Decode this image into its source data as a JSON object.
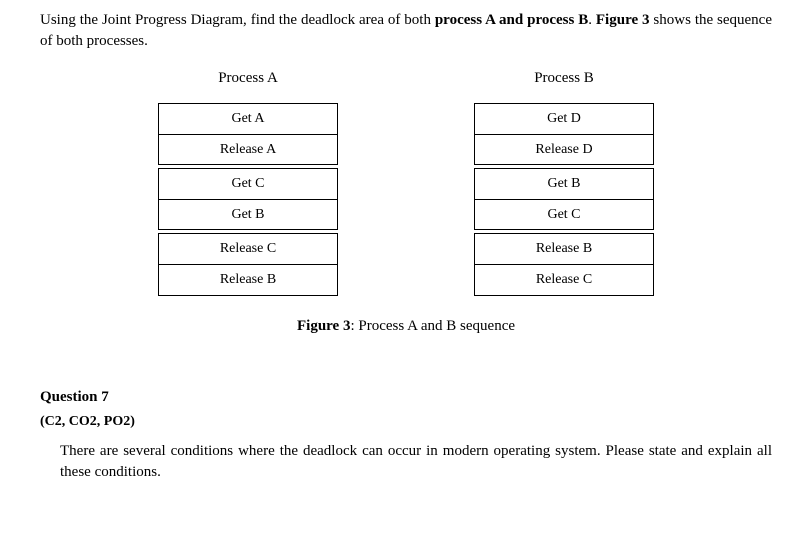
{
  "intro": {
    "prefix": "Using the Joint Progress Diagram, find the deadlock area of both ",
    "bold": "process A and process B",
    "middle": ". ",
    "figbold": "Figure 3",
    "suffix": " shows the sequence of both processes."
  },
  "processA": {
    "title": "Process A",
    "steps": [
      "Get A",
      "Release A",
      "Get C",
      "Get B",
      "Release C",
      "Release B"
    ]
  },
  "processB": {
    "title": "Process B",
    "steps": [
      "Get D",
      "Release D",
      "Get B",
      "Get C",
      "Release B",
      "Release C"
    ]
  },
  "figure": {
    "label": "Figure 3",
    "caption": ": Process A and B sequence"
  },
  "question": {
    "heading": "Question 7",
    "codes": "(C2, CO2, PO2)",
    "text": "There are several conditions where the deadlock can occur in modern operating system. Please state and explain all these conditions."
  }
}
